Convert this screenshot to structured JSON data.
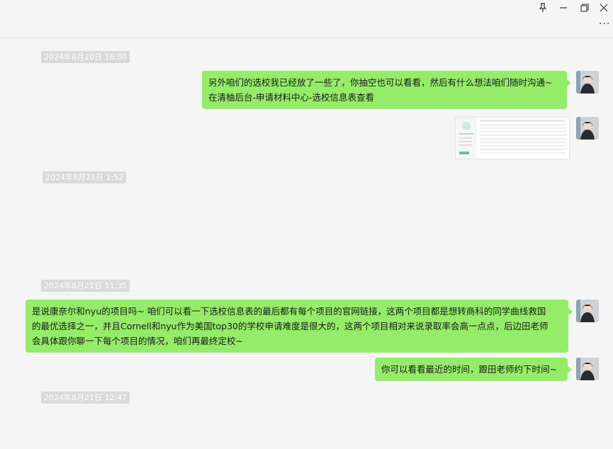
{
  "window": {
    "controls": {
      "pin_icon": "pin-icon",
      "minimize_icon": "minimize-icon",
      "restore_icon": "restore-icon",
      "close_icon": "close-icon",
      "more_icon": "more-icon"
    }
  },
  "messages": {
    "timestamp_1": "2024年8月20日 16:00",
    "msg_1_line_1": "另外咱们的选校我已经放了一些了，你抽空也可以看看，然后有什么想法咱们随时沟通~",
    "msg_1_line_2": "在清柚后台-申请材料中心-选校信息表查看",
    "timestamp_2": "2024年8月21日 1:52",
    "timestamp_3": "2024年8月21日 11:35",
    "msg_3_line_1": "是说康奈尔和nyu的项目吗~  咱们可以看一下选校信息表的最后都有每个项目的官网链接，这两个项目都是想转商科的同学曲线救国",
    "msg_3_line_2": "的最优选择之一，并且Cornell和nyu作为美国top30的学校申请难度是很大的，这两个项目相对来说录取率会高一点点，后边田老师",
    "msg_3_line_3": "会具体跟你聊一下每个项目的情况，咱们再最终定校~",
    "msg_4": "你可以看看最近的时间，跟田老师约下时间~",
    "timestamp_4": "2024年8月21日 12:47"
  },
  "colors": {
    "bubble_green": "#95ec69",
    "background": "#f5f5f5",
    "timestamp_bg": "#dadada"
  }
}
